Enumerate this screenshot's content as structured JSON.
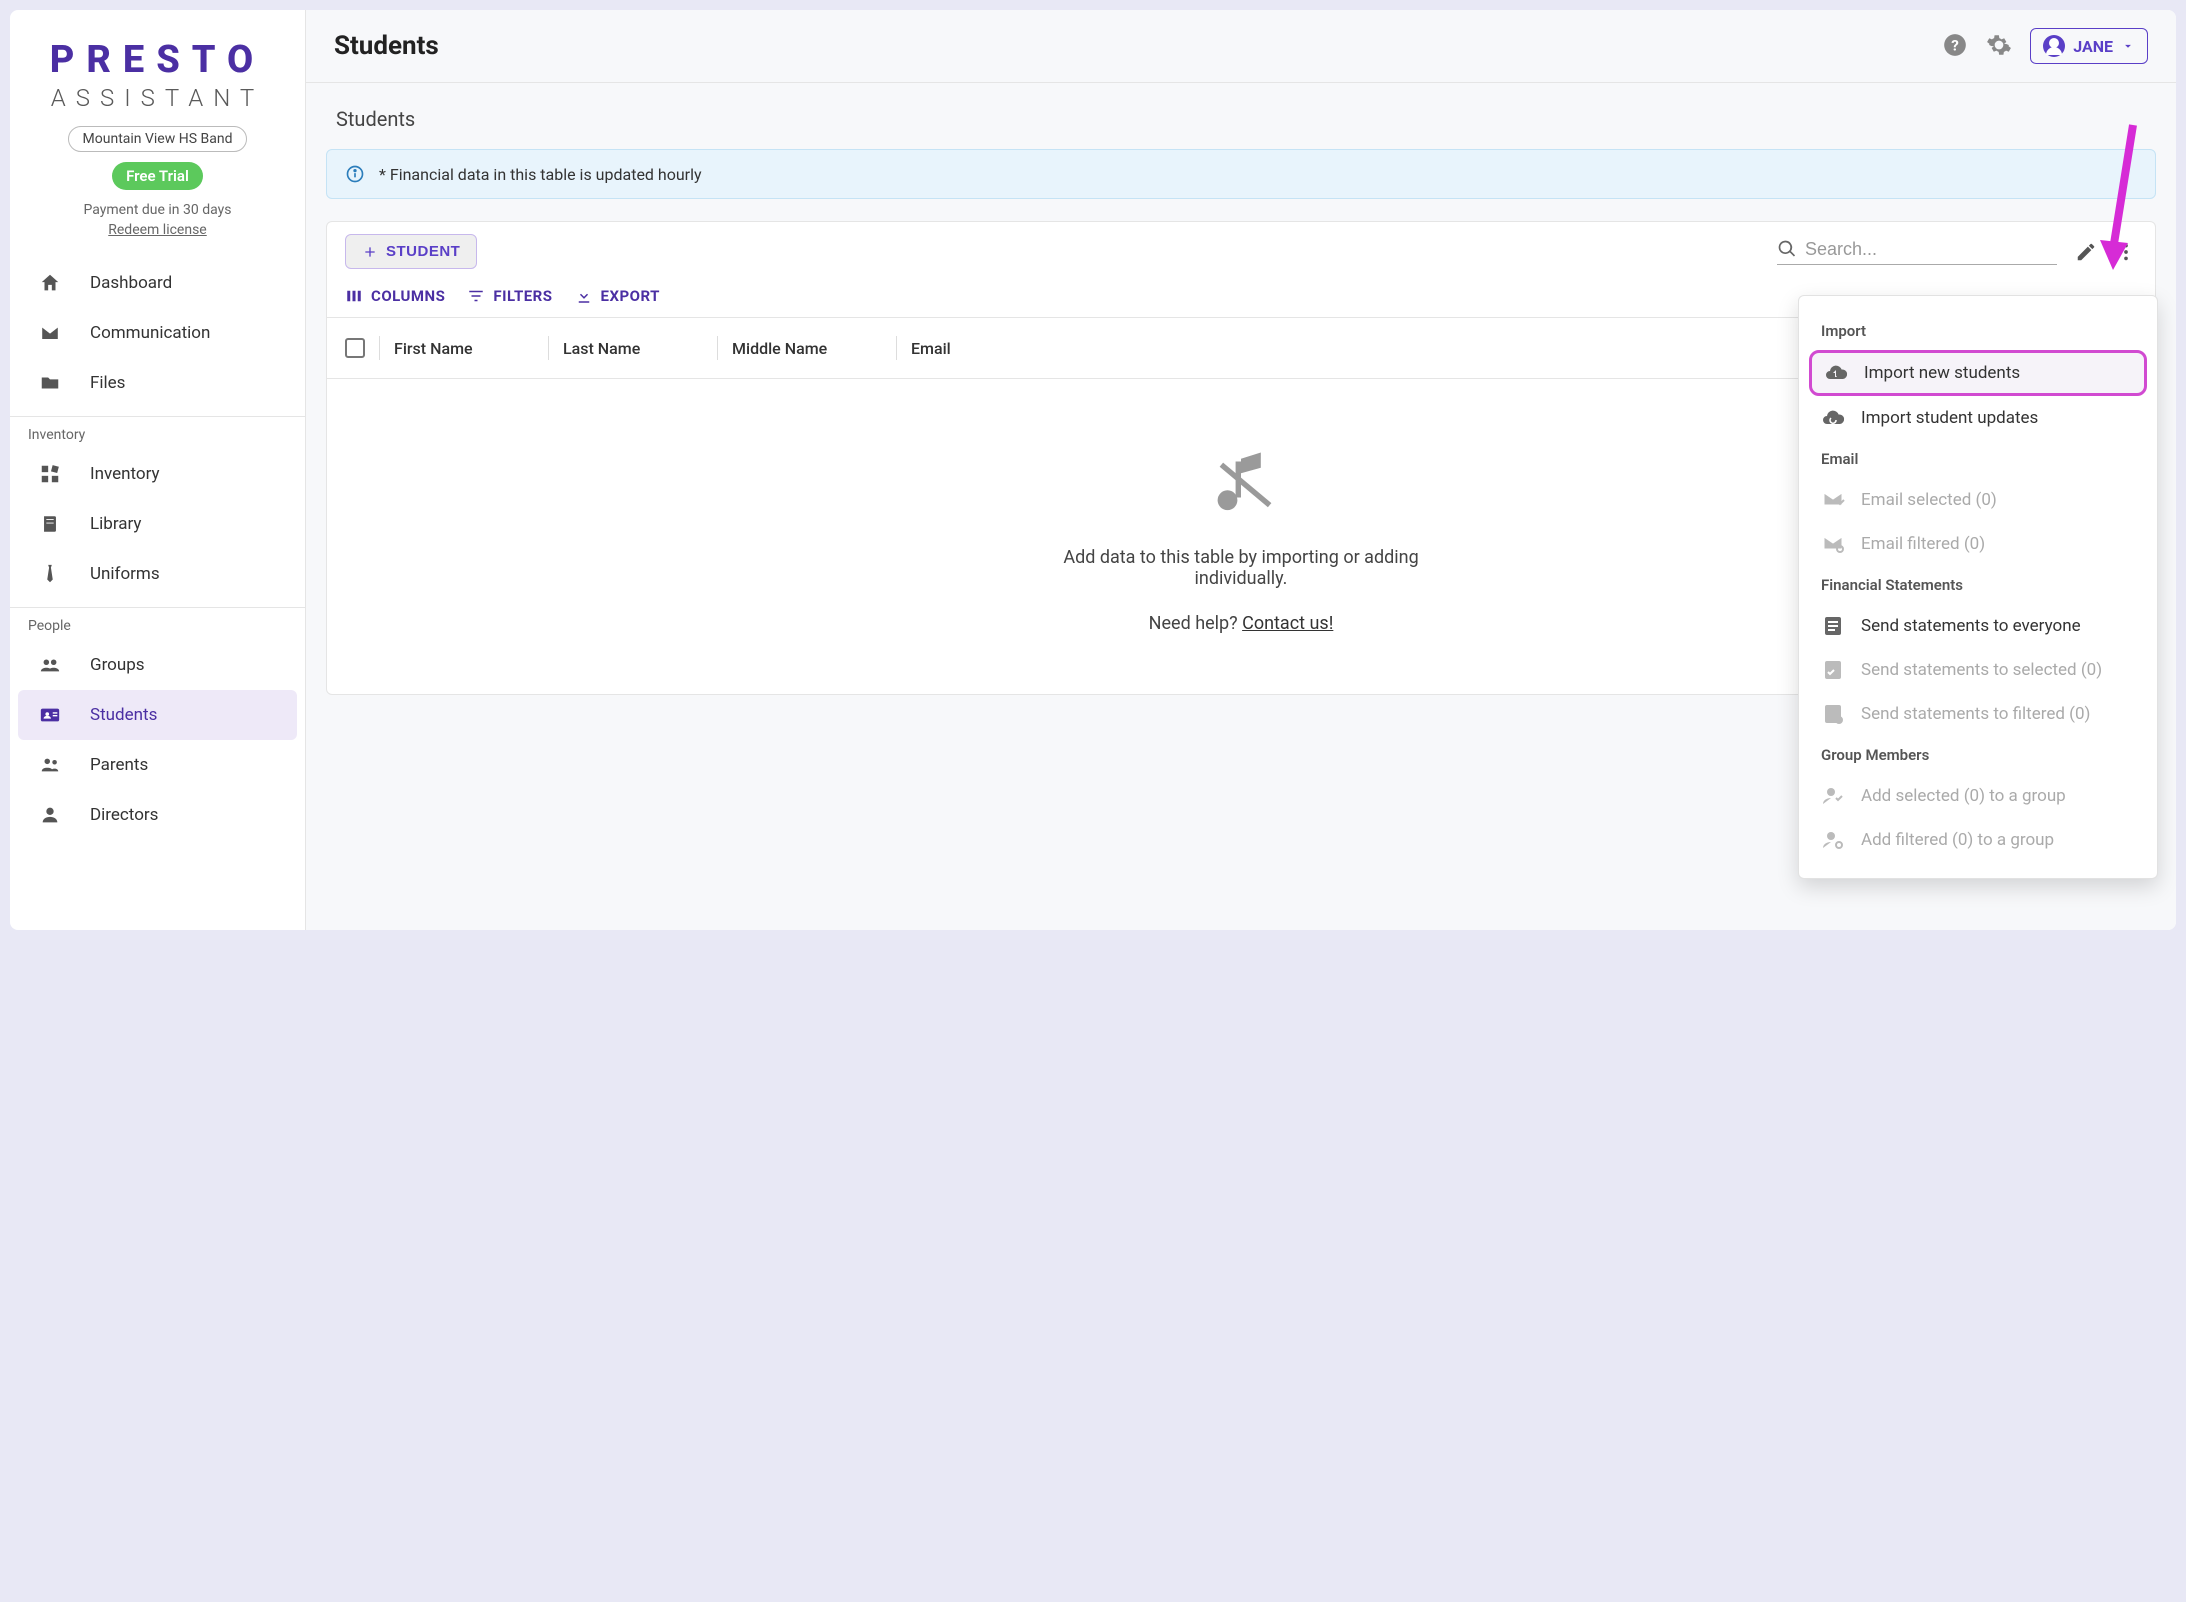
{
  "brand": {
    "main": "PRESTO",
    "sub": "ASSISTANT"
  },
  "org": "Mountain View HS Band",
  "trial_badge": "Free Trial",
  "payment_due": "Payment due in 30 days",
  "redeem": "Redeem license",
  "nav": {
    "items": [
      "Dashboard",
      "Communication",
      "Files"
    ],
    "inventory_label": "Inventory",
    "inventory_items": [
      "Inventory",
      "Library",
      "Uniforms"
    ],
    "people_label": "People",
    "people_items": [
      "Groups",
      "Students",
      "Parents",
      "Directors"
    ]
  },
  "header": {
    "title": "Students",
    "user": "JANE"
  },
  "section_title": "Students",
  "banner": "* Financial data in this table is updated hourly",
  "toolbar": {
    "add_student": "STUDENT",
    "columns": "COLUMNS",
    "filters": "FILTERS",
    "export": "EXPORT",
    "search_placeholder": "Search..."
  },
  "table": {
    "columns": [
      "First Name",
      "Last Name",
      "Middle Name",
      "Email"
    ]
  },
  "empty": {
    "line": "Add data to this table by importing or adding individually.",
    "need_help": "Need help? ",
    "contact": "Contact us!"
  },
  "dropdown": {
    "import_header": "Import",
    "import_new": "Import new students",
    "import_updates": "Import student updates",
    "email_header": "Email",
    "email_selected": "Email selected (0)",
    "email_filtered": "Email filtered (0)",
    "fs_header": "Financial Statements",
    "fs_everyone": "Send statements to everyone",
    "fs_selected": "Send statements to selected (0)",
    "fs_filtered": "Send statements to filtered (0)",
    "gm_header": "Group Members",
    "gm_selected": "Add selected (0) to a group",
    "gm_filtered": "Add filtered (0) to a group"
  }
}
